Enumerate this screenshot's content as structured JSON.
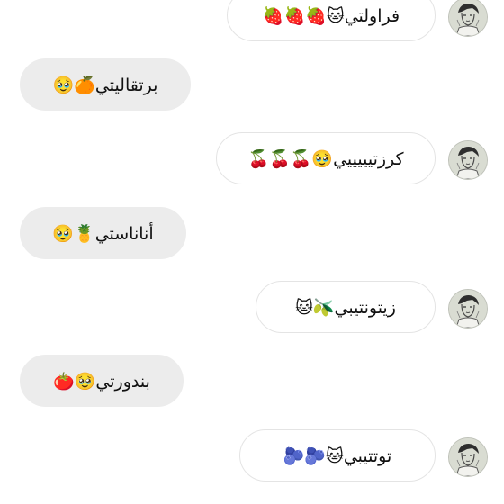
{
  "messages": [
    {
      "side": "sent",
      "text": "فراولتي🐱🍓🍓🍓"
    },
    {
      "side": "received",
      "text": "برتقاليتي🍊🥹"
    },
    {
      "side": "sent",
      "text": "كرزتيييييي🥹🍒🍒🍒"
    },
    {
      "side": "received",
      "text": "أناناستي🍍🥹"
    },
    {
      "side": "sent",
      "text": "زيتونتيبي🫒🐱"
    },
    {
      "side": "received",
      "text": "بندورتي🥹🍅"
    },
    {
      "side": "sent",
      "text": "توتتيبي🐱🫐🫐"
    }
  ],
  "avatar": {
    "icon": "sketch-portrait-avatar"
  }
}
